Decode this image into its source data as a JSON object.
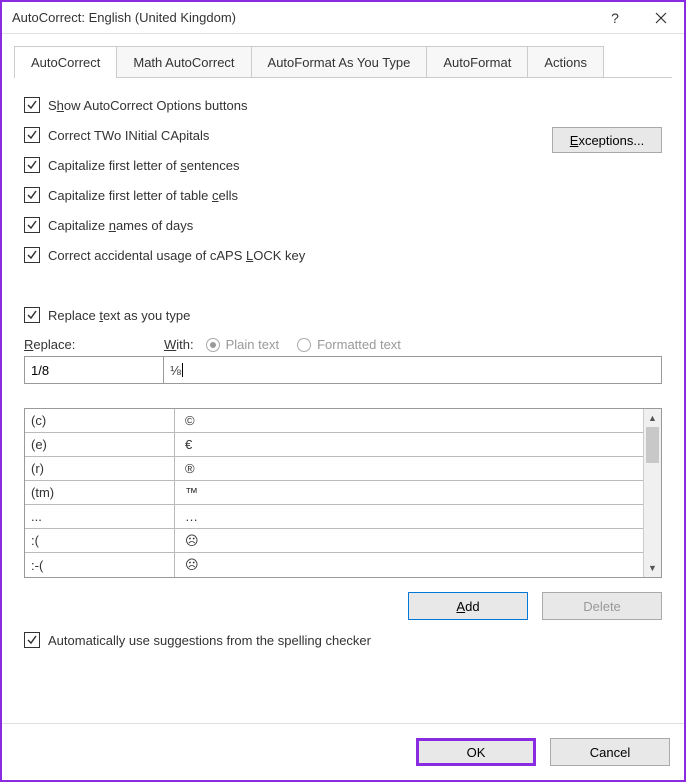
{
  "window": {
    "title": "AutoCorrect: English (United Kingdom)"
  },
  "tabs": {
    "autocorrect": "AutoCorrect",
    "math": "Math AutoCorrect",
    "autoformat_type": "AutoFormat As You Type",
    "autoformat": "AutoFormat",
    "actions": "Actions"
  },
  "checks": {
    "show_opts": "Show AutoCorrect Options buttons",
    "two_caps": "Correct TWo INitial CApitals",
    "sentences": "Capitalize first letter of sentences",
    "cells": "Capitalize first letter of table cells",
    "days": "Capitalize names of days",
    "capslock": "Correct accidental usage of cAPS LOCK key",
    "replace_as_type": "Replace text as you type",
    "spell_suggest": "Automatically use suggestions from the spelling checker"
  },
  "buttons": {
    "exceptions": "Exceptions...",
    "add": "Add",
    "delete": "Delete",
    "ok": "OK",
    "cancel": "Cancel"
  },
  "labels": {
    "replace": "Replace:",
    "with": "With:",
    "plain": "Plain text",
    "formatted": "Formatted text"
  },
  "inputs": {
    "replace_val": "1/8",
    "with_val": "⅛"
  },
  "list": [
    {
      "l": "(c)",
      "r": "©"
    },
    {
      "l": "(e)",
      "r": "€"
    },
    {
      "l": "(r)",
      "r": "®"
    },
    {
      "l": "(tm)",
      "r": "™"
    },
    {
      "l": "...",
      "r": "…"
    },
    {
      "l": ":(",
      "r": "☹"
    },
    {
      "l": ":-(",
      "r": "☹"
    }
  ]
}
